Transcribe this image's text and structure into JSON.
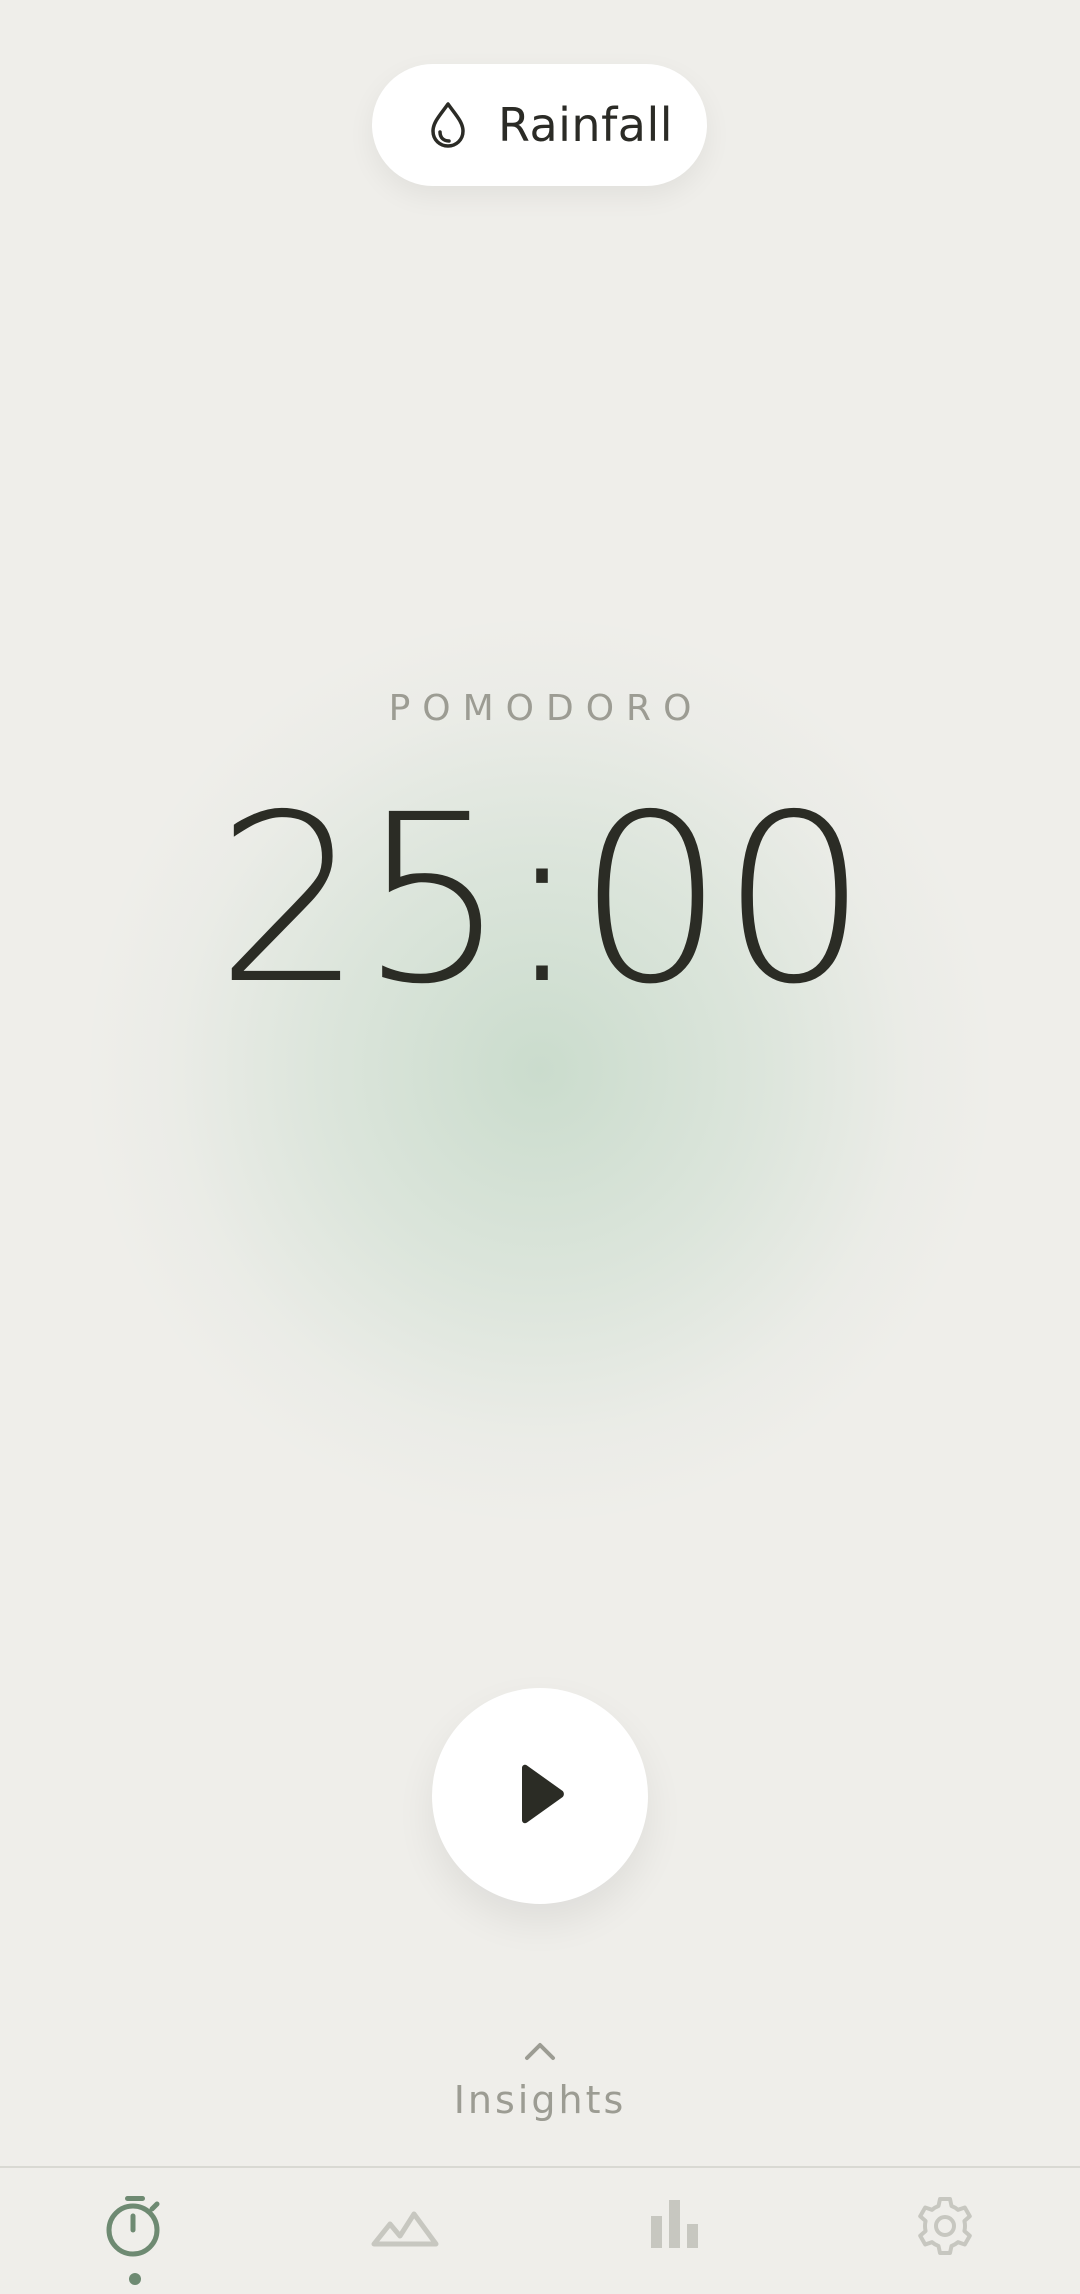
{
  "sound": {
    "label": "Rainfall",
    "icon": "water-drop-icon"
  },
  "timer": {
    "mode": "POMODORO",
    "time": "25:00"
  },
  "controls": {
    "play_icon": "play-icon"
  },
  "insights": {
    "label": "Insights",
    "icon": "chevron-up-icon"
  },
  "nav": {
    "items": [
      {
        "icon": "stopwatch-icon",
        "active": true
      },
      {
        "icon": "mountain-icon",
        "active": false
      },
      {
        "icon": "bar-chart-icon",
        "active": false
      },
      {
        "icon": "gear-icon",
        "active": false
      }
    ]
  },
  "colors": {
    "background": "#efeeea",
    "accent": "#6e8a72",
    "text": "#2b2c25",
    "muted": "#9c9c93",
    "inactive_icon": "#c7c7c0"
  }
}
